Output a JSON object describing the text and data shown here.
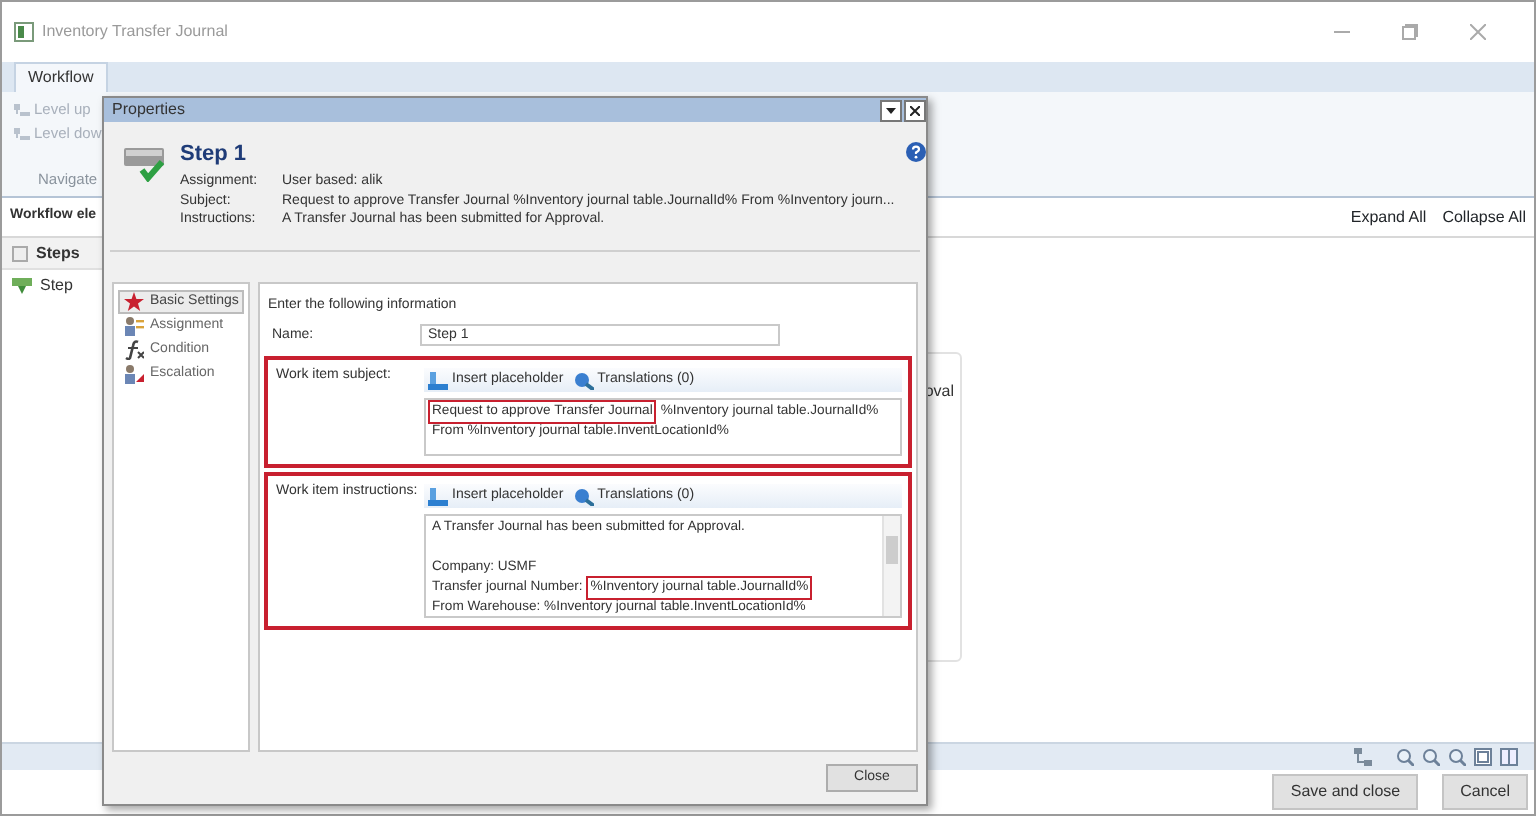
{
  "window": {
    "title": "Inventory Transfer Journal"
  },
  "ribbon": {
    "tabs": [
      {
        "label": "Workflow",
        "selected": true
      }
    ],
    "buttons": [
      {
        "label": "Level up",
        "disabled": true
      },
      {
        "label": "Level dow",
        "disabled": true
      }
    ],
    "group": "Navigate"
  },
  "workflow_elements": {
    "title": "Workflow ele",
    "tree": [
      {
        "label": "Steps",
        "checked": false,
        "children": [
          {
            "label": "Step"
          }
        ]
      }
    ]
  },
  "canvas": {
    "links": [
      "Expand All",
      "Collapse All"
    ],
    "nodes": [
      {
        "text": "oval"
      }
    ]
  },
  "buttons": [
    "Save and close",
    "Cancel"
  ],
  "dialog": {
    "title": "Properties",
    "step": {
      "title": "Step 1",
      "details": [
        {
          "label": "Assignment:",
          "value": "User based: alik"
        },
        {
          "label": "Subject:",
          "value": "Request to approve Transfer Journal %Inventory journal table.JournalId% From %Inventory journ..."
        },
        {
          "label": "Instructions:",
          "value": "A Transfer Journal has been submitted for Approval."
        }
      ]
    },
    "nav": [
      {
        "label": "Basic Settings",
        "selected": true
      },
      {
        "label": "Assignment",
        "selected": false
      },
      {
        "label": "Condition",
        "selected": false
      },
      {
        "label": "Escalation",
        "selected": false
      }
    ],
    "heading": "Enter the following information",
    "name": {
      "label": "Name:",
      "value": "Step 1"
    },
    "fields": [
      {
        "label": "Work item subject:",
        "highlighted": true,
        "actions": [
          "Insert placeholder",
          "Translations (0)"
        ],
        "lines": [
          {
            "segments": [
              {
                "text": "Request to approve Transfer Journal",
                "highlighted": true
              },
              {
                "text": "%Inventory journal table.JournalId%",
                "highlighted": false
              }
            ]
          },
          {
            "segments": [
              {
                "text": "From %Inventory journal table.InventLocationId%",
                "highlighted": false
              }
            ]
          }
        ]
      },
      {
        "label": "Work item instructions:",
        "highlighted": true,
        "actions": [
          "Insert placeholder",
          "Translations (0)"
        ],
        "lines": [
          {
            "segments": [
              {
                "text": "A Transfer Journal has been submitted for Approval.",
                "highlighted": false
              }
            ]
          },
          {
            "gap_before": true,
            "segments": [
              {
                "text": "Company: USMF",
                "highlighted": false
              }
            ]
          },
          {
            "segments": [
              {
                "text": "Transfer journal Number:",
                "highlighted": false
              },
              {
                "text": "%Inventory journal table.JournalId%",
                "highlighted": true
              }
            ]
          },
          {
            "segments": [
              {
                "text": "From Warehouse: %Inventory journal table.InventLocationId%",
                "highlighted": false
              }
            ]
          }
        ]
      }
    ],
    "close": "Close"
  }
}
